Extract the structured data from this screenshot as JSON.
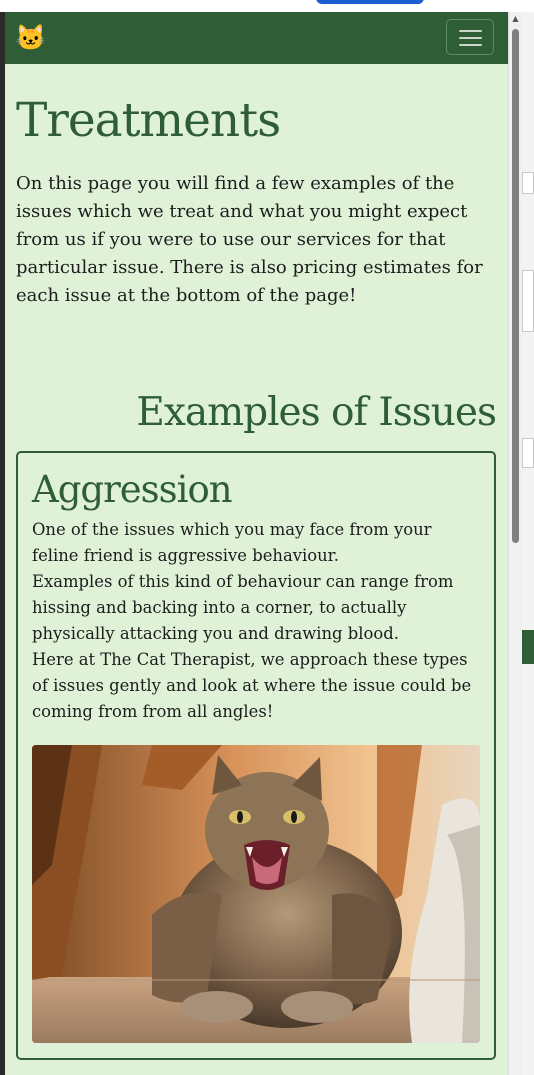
{
  "navbar": {
    "brand_icon": "cat-face-icon",
    "brand_glyph": "🐱",
    "menu_icon": "hamburger-menu-icon"
  },
  "page": {
    "title": "Treatments",
    "intro": "On this page you will find a few examples of the issues which we treat and what you might expect from us if you were to use our services for that particular issue. There is also pricing estimates for each issue at the bottom of the page!",
    "section_title": "Examples of Issues"
  },
  "issues": [
    {
      "title": "Aggression",
      "paragraphs": [
        "One of the issues which you may face from your feline friend is aggressive behaviour.",
        "Examples of this kind of behaviour can range from hissing and backing into a corner, to actually physically attacking you and drawing blood.",
        "Here at The Cat Therapist, we approach these types of issues gently and look at where the issue could be coming from from all angles!"
      ],
      "image_description_icon": "hissing-cat-photo"
    }
  ],
  "colors": {
    "brand_green": "#2f5d36",
    "page_background": "#dff2d8",
    "text": "#1c1c1c"
  }
}
